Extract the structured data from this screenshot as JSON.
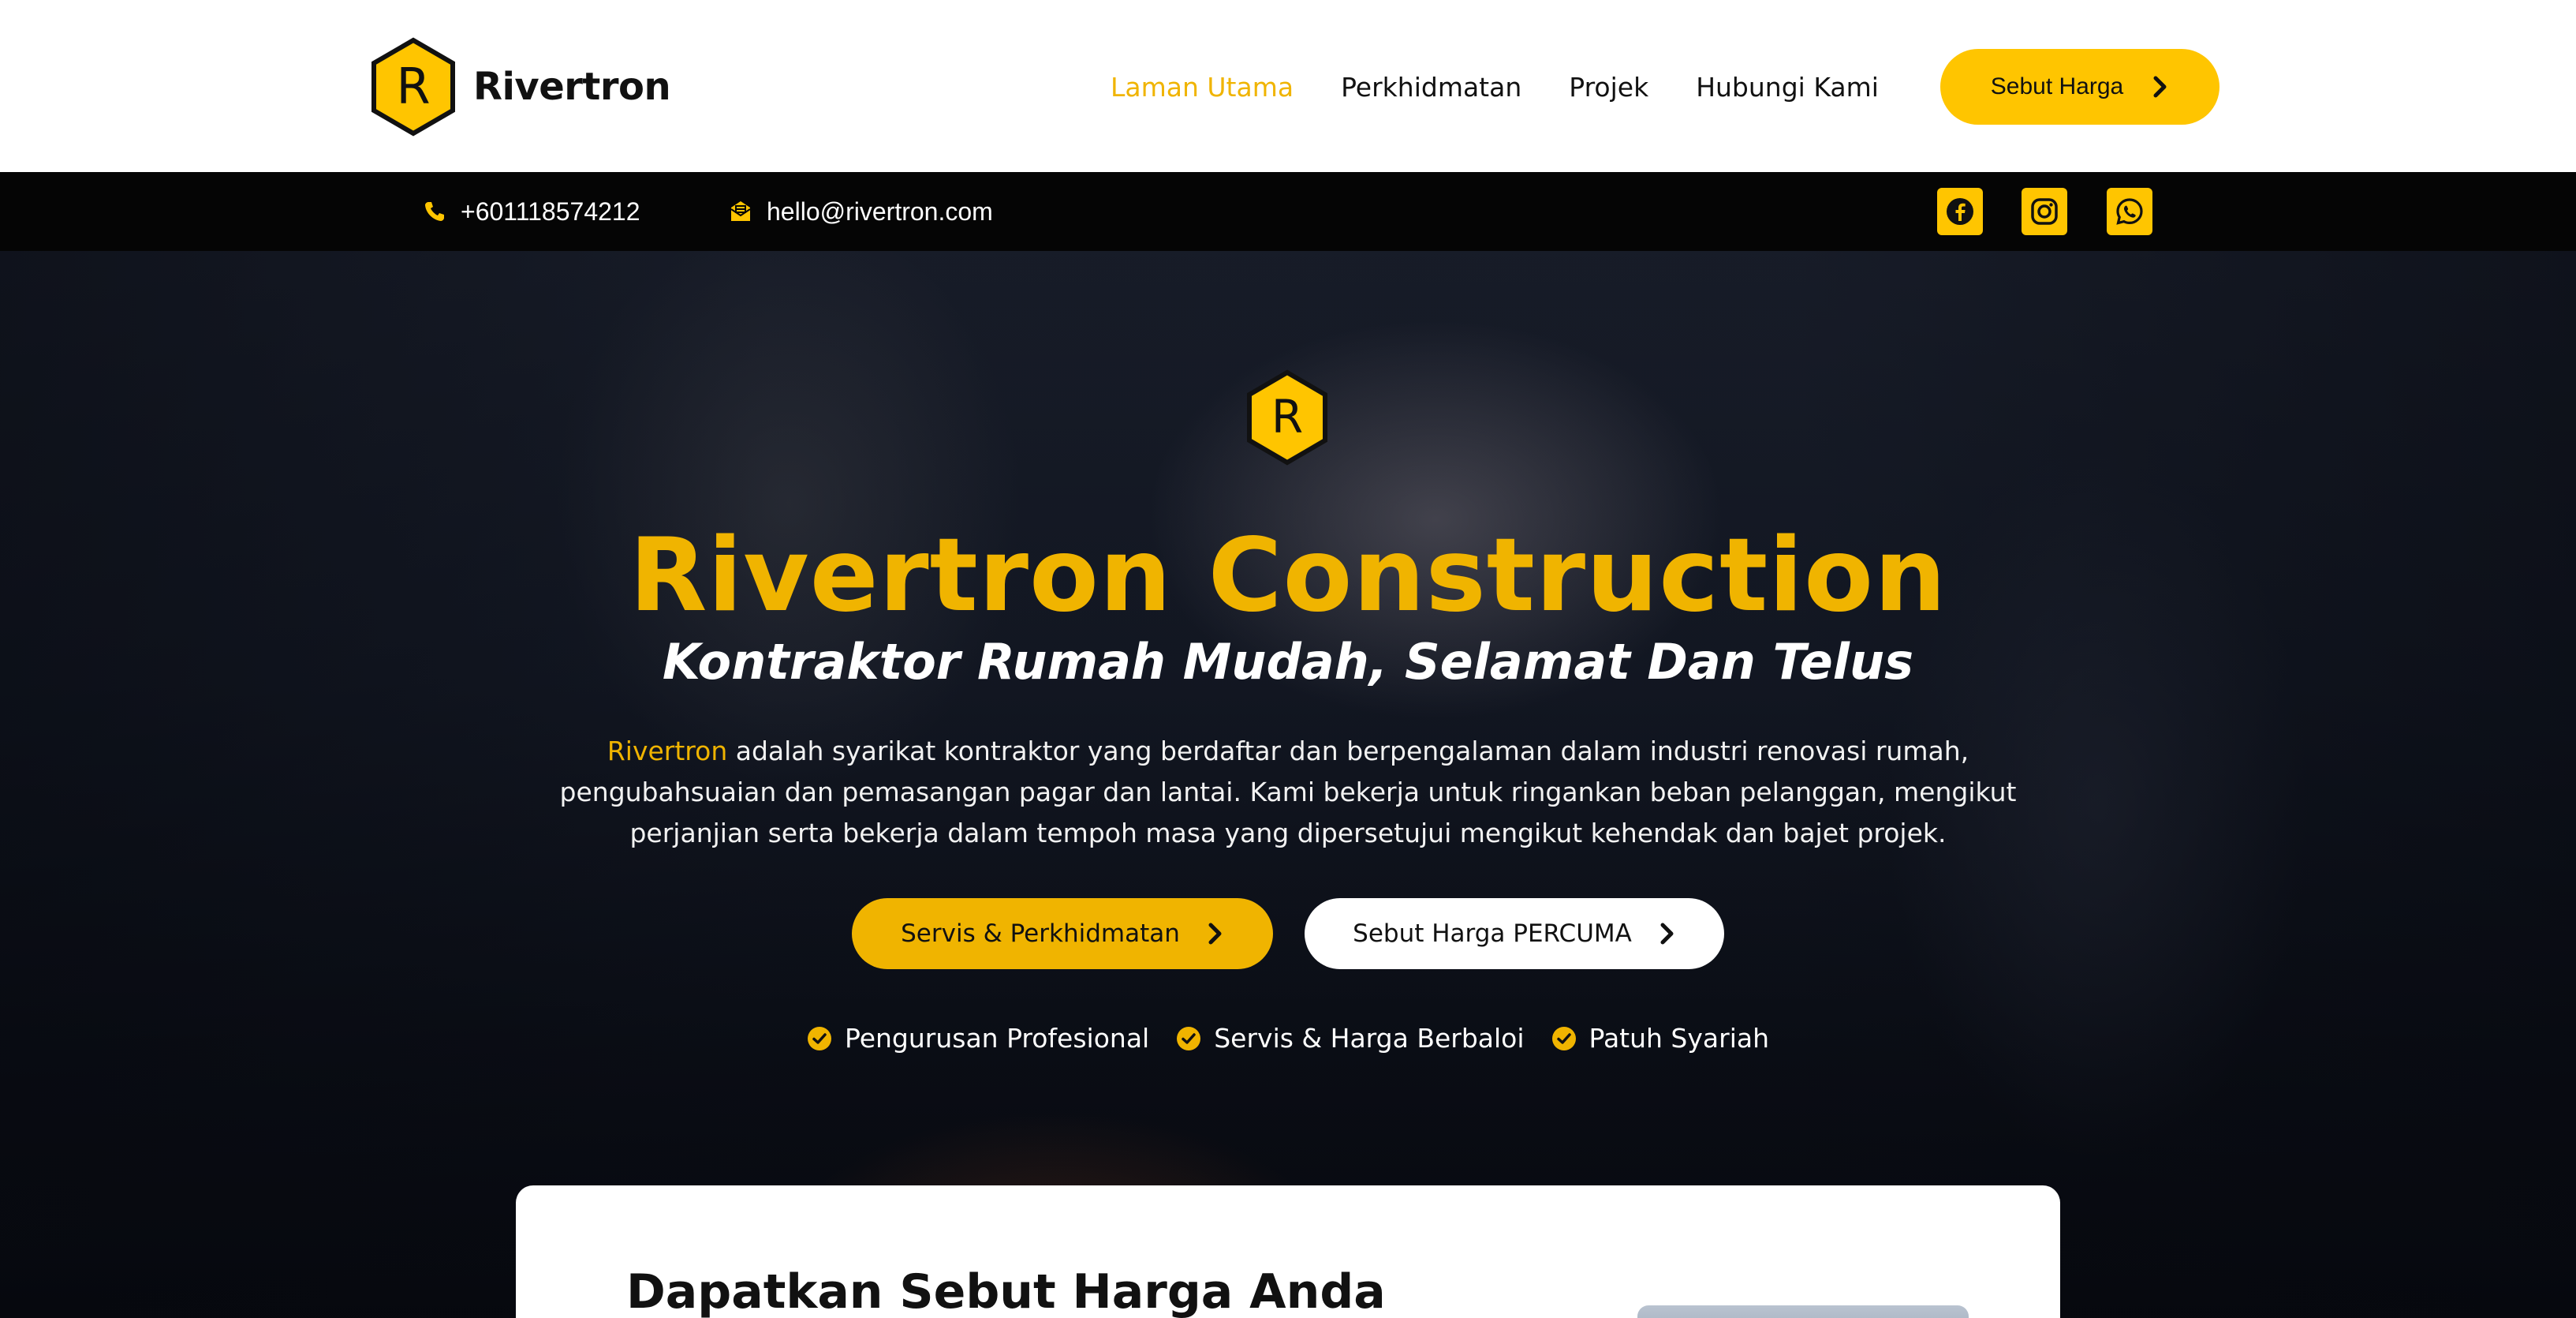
{
  "header": {
    "brand": "Rivertron",
    "logo_letter": "R",
    "nav": [
      {
        "label": "Laman Utama",
        "active": true
      },
      {
        "label": "Perkhidmatan",
        "active": false
      },
      {
        "label": "Projek",
        "active": false
      },
      {
        "label": "Hubungi Kami",
        "active": false
      }
    ],
    "cta_label": "Sebut Harga"
  },
  "infobar": {
    "phone": "+601118574212",
    "email": "hello@rivertron.com",
    "phone_icon": "phone-icon",
    "email_icon": "email-icon",
    "socials": [
      "facebook-icon",
      "instagram-icon",
      "whatsapp-icon"
    ]
  },
  "hero": {
    "emblem_letter": "R",
    "title": "Rivertron Construction",
    "subtitle": "Kontraktor Rumah Mudah, Selamat Dan Telus",
    "description_brand": "Rivertron",
    "description_line1": " adalah syarikat kontraktor yang berdaftar dan berpengalaman dalam industri renovasi rumah,",
    "description_line2": "pengubahsuaian dan pemasangan pagar dan lantai. Kami bekerja untuk ringankan beban pelanggan, mengikut",
    "description_line3": "perjanjian serta bekerja dalam tempoh masa yang dipersetujui mengikut kehendak dan bajet projek.",
    "primary_button": "Servis & Perkhidmatan",
    "secondary_button": "Sebut Harga PERCUMA",
    "features": [
      "Pengurusan Profesional",
      "Servis & Harga Berbaloi",
      "Patuh Syariah"
    ]
  },
  "quote_card": {
    "title": "Dapatkan Sebut Harga Anda"
  },
  "colors": {
    "accent": "#ffc500",
    "accent_dark": "#f0b400",
    "topbar": "#050505",
    "text_dark": "#111111"
  }
}
